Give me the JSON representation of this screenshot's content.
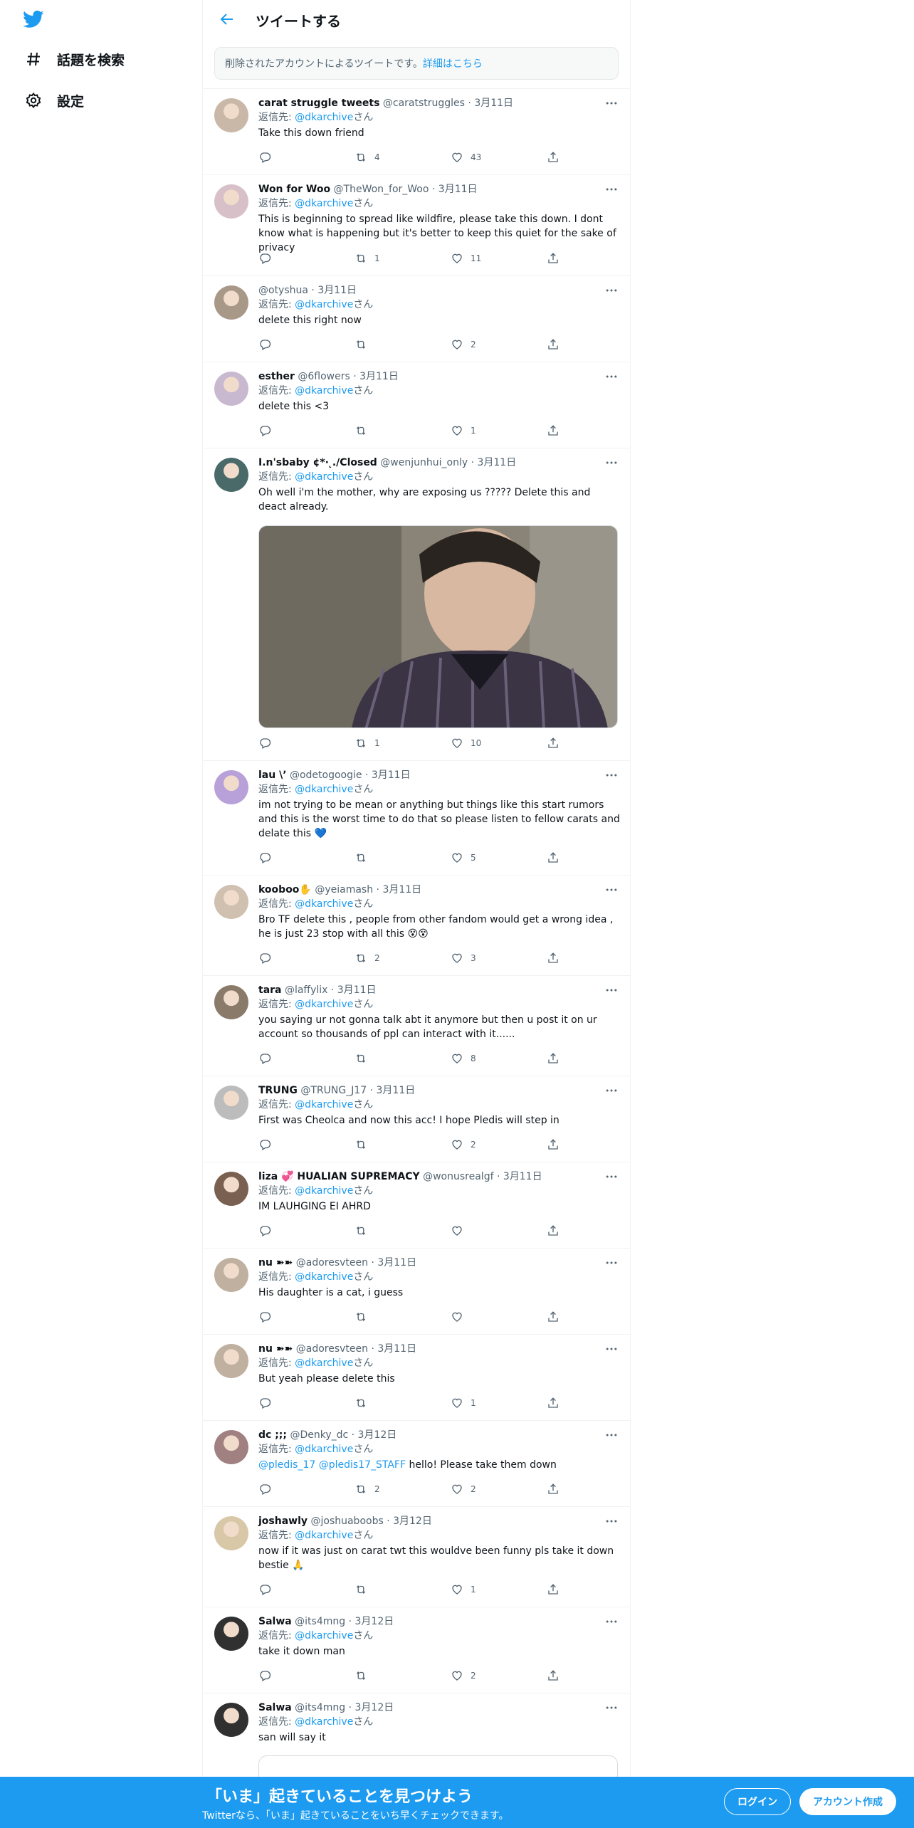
{
  "nav": {
    "items": [
      {
        "label": "話題を検索",
        "icon": "hashtag-icon"
      },
      {
        "label": "設定",
        "icon": "gear-icon"
      }
    ]
  },
  "header": {
    "title": "ツイートする"
  },
  "notice": {
    "text": "削除されたアカウントによるツイートです。",
    "link": "詳細はこちら"
  },
  "reply_prefix": "返信先: ",
  "reply_suffix": "さん",
  "tweets": [
    {
      "name": "carat struggle tweets",
      "handle": "@caratstruggles",
      "date": "· 3月11日",
      "reply_to": "@dkarchive",
      "text": "Take this down friend",
      "retweets": "4",
      "likes": "43"
    },
    {
      "name": "Won for Woo",
      "handle": "@TheWon_for_Woo",
      "date": "· 3月11日",
      "reply_to": "@dkarchive",
      "text": "This is beginning to spread like wildfire, please take this down. I dont know what is happening but it's better to keep this quiet for the sake of privacy",
      "retweets": "1",
      "likes": "11"
    },
    {
      "name": "",
      "handle": "@otyshua",
      "date": "· 3月11日",
      "reply_to": "@dkarchive",
      "text": "delete this right now",
      "retweets": "",
      "likes": "2"
    },
    {
      "name": "esther",
      "handle": "@6flowers",
      "date": "· 3月11日",
      "reply_to": "@dkarchive",
      "text": "delete this <3",
      "retweets": "",
      "likes": "1"
    },
    {
      "name": "I.n'sbaby ¢*· ̨./Closed",
      "handle": "@wenjunhui_only",
      "date": "· 3月11日",
      "reply_to": "@dkarchive",
      "text": "Oh well i'm the mother, why are exposing us ????? Delete this and deact already.",
      "retweets": "1",
      "likes": "10"
    },
    {
      "name": "lau \\ʼ",
      "handle": "@odetogoogie",
      "date": "· 3月11日",
      "reply_to": "@dkarchive",
      "text": "im not trying to be mean or anything but things like this start rumors and this is the worst time to do that so please listen to fellow carats and delate this 💙",
      "retweets": "",
      "likes": "5"
    },
    {
      "name": "kooboo✋",
      "handle": "@yeiamash",
      "date": "· 3月11日",
      "reply_to": "@dkarchive",
      "text": "Bro TF delete this , people from other fandom would get a wrong idea , he is just 23 stop with all this 😵😵",
      "retweets": "2",
      "likes": "3"
    },
    {
      "name": "tara",
      "handle": "@laffylix",
      "date": "· 3月11日",
      "reply_to": "@dkarchive",
      "text": "you saying ur not gonna talk abt it anymore but then u post it on ur account so thousands of ppl can interact with it......",
      "retweets": "",
      "likes": "8"
    },
    {
      "name": "TRUNG",
      "handle": "@TRUNG_J17",
      "date": "· 3月11日",
      "reply_to": "@dkarchive",
      "text": "First was Cheolca and now this acc! I hope Pledis will step in",
      "retweets": "",
      "likes": "2"
    },
    {
      "name": "liza 💞 HUALIAN SUPREMACY",
      "handle": "@wonusrealgf",
      "date": "· 3月11日",
      "reply_to": "@dkarchive",
      "text": "IM LAUHGING EI AHRD",
      "retweets": "",
      "likes": ""
    },
    {
      "name": "nu ➽➽",
      "handle": "@adoresvteen",
      "date": "· 3月11日",
      "reply_to": "@dkarchive",
      "text": "His daughter is a cat, i guess",
      "retweets": "",
      "likes": ""
    },
    {
      "name": "nu ➽➽",
      "handle": "@adoresvteen",
      "date": "· 3月11日",
      "reply_to": "@dkarchive",
      "text": "But yeah please delete this",
      "retweets": "",
      "likes": "1"
    },
    {
      "name": "dc ;;;",
      "handle": "@Denky_dc",
      "date": "· 3月12日",
      "reply_to": "@dkarchive",
      "text_mentions": "@pledis_17 @pledis17_STAFF",
      "text": " hello! Please take them down",
      "retweets": "2",
      "likes": "2"
    },
    {
      "name": "joshawly",
      "handle": "@joshuaboobs",
      "date": "· 3月12日",
      "reply_to": "@dkarchive",
      "text": "now if it was just on carat twt this wouldve been funny pls take it down bestie 🙏",
      "retweets": "",
      "likes": "1"
    },
    {
      "name": "Salwa",
      "handle": "@its4mng",
      "date": "· 3月12日",
      "reply_to": "@dkarchive",
      "text": "take it down man",
      "retweets": "",
      "likes": "2"
    },
    {
      "name": "Salwa",
      "handle": "@its4mng",
      "date": "· 3月12日",
      "reply_to": "@dkarchive",
      "text": "san will say it",
      "retweets": "",
      "likes": ""
    }
  ],
  "bottom_bar": {
    "title": "「いま」起きていることを見つけよう",
    "subtitle": "Twitterなら、「いま」起きていることをいち早くチェックできます。",
    "login": "ログイン",
    "signup": "アカウント作成"
  },
  "colors": {
    "accent": "#1d9bf0",
    "text": "#0f1419",
    "muted": "#536471"
  }
}
